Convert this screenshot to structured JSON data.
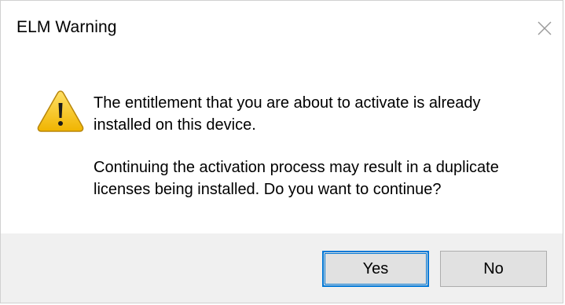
{
  "dialog": {
    "title": "ELM Warning",
    "close_icon": "close-icon",
    "warning_icon": "warning-triangle-icon",
    "message_line1": "The entitlement that you are about to activate is already installed on this device.",
    "message_line2": "Continuing the activation process may result in a duplicate licenses being installed. Do you want to continue?",
    "buttons": {
      "yes_label": "Yes",
      "no_label": "No"
    },
    "colors": {
      "footer_bg": "#f0f0f0",
      "focus_border": "#0078d7",
      "warning_yellow": "#f5c518"
    }
  }
}
